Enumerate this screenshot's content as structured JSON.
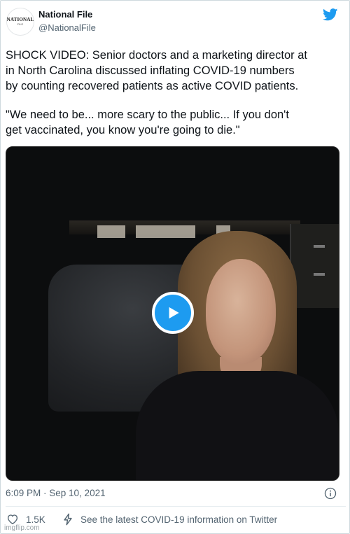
{
  "author": {
    "name": "National File",
    "handle": "@NationalFile",
    "avatar_line1": "NATIONAL",
    "avatar_line2": "FILE"
  },
  "tweet": {
    "paragraphs": [
      "SHOCK VIDEO: Senior doctors and a marketing director at\nin North Carolina discussed inflating COVID-19 numbers\nby counting recovered patients as active COVID patients.",
      "\"We need to be... more scary to the public... If you don't\nget vaccinated, you know you're going to die.\""
    ]
  },
  "media": {
    "type": "video"
  },
  "meta": {
    "timestamp": "6:09 PM · Sep 10, 2021"
  },
  "actions": {
    "like_count": "1.5K",
    "covid_info": "See the latest COVID-19 information on Twitter"
  },
  "watermark": "imgflip.com",
  "colors": {
    "accent": "#1d9bf0",
    "secondary_text": "#536471"
  },
  "icons": [
    "twitter-bird-icon",
    "play-icon",
    "info-icon",
    "heart-icon",
    "lightning-icon"
  ]
}
